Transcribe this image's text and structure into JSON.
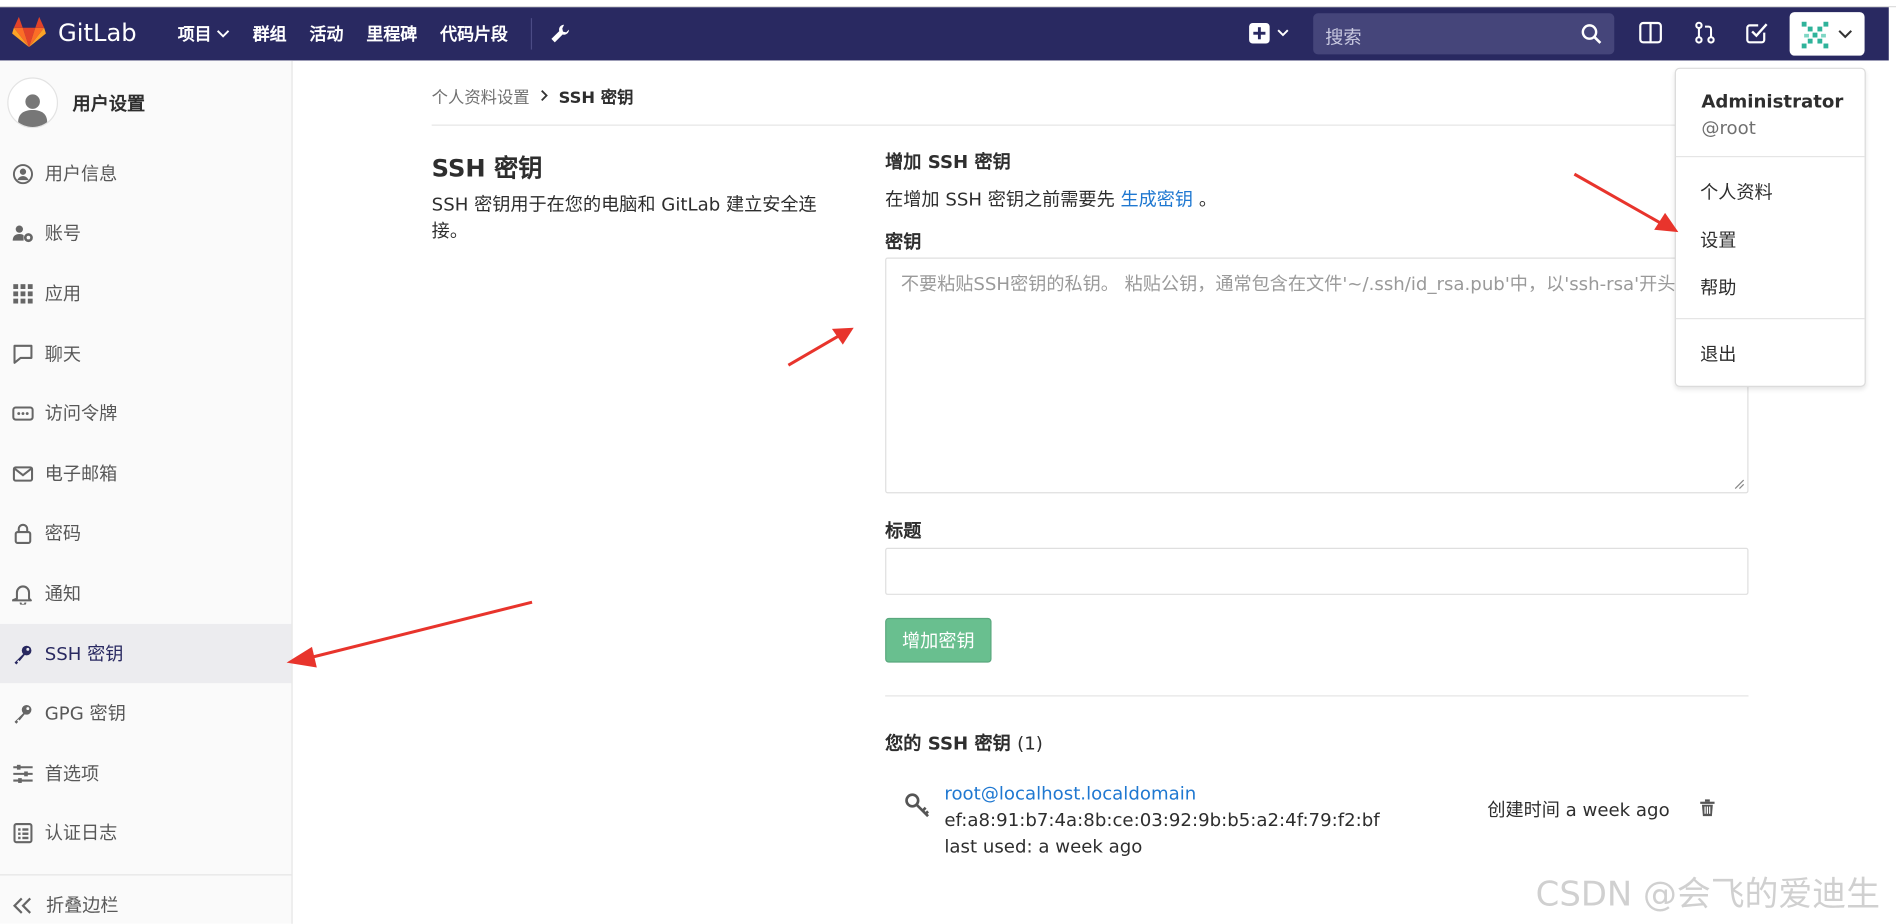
{
  "topbar": {
    "logo_text": "GitLab",
    "nav": [
      {
        "label": "项目",
        "dropdown": true
      },
      {
        "label": "群组",
        "dropdown": false
      },
      {
        "label": "活动",
        "dropdown": false
      },
      {
        "label": "里程碑",
        "dropdown": false
      },
      {
        "label": "代码片段",
        "dropdown": false
      }
    ],
    "search_placeholder": "搜索",
    "bg_color": "#292961"
  },
  "sidebar": {
    "title": "用户设置",
    "items": [
      {
        "label": "用户信息",
        "icon": "user-circle-icon"
      },
      {
        "label": "账号",
        "icon": "account-gear-icon"
      },
      {
        "label": "应用",
        "icon": "grid-icon"
      },
      {
        "label": "聊天",
        "icon": "chat-icon"
      },
      {
        "label": "访问令牌",
        "icon": "token-icon"
      },
      {
        "label": "电子邮箱",
        "icon": "mail-icon"
      },
      {
        "label": "密码",
        "icon": "lock-icon"
      },
      {
        "label": "通知",
        "icon": "bell-icon"
      },
      {
        "label": "SSH 密钥",
        "icon": "key-icon",
        "active": true
      },
      {
        "label": "GPG 密钥",
        "icon": "key-icon"
      },
      {
        "label": "首选项",
        "icon": "sliders-icon"
      },
      {
        "label": "认证日志",
        "icon": "log-icon"
      }
    ],
    "collapse_label": "折叠边栏"
  },
  "breadcrumb": {
    "parent": "个人资料设置",
    "current": "SSH 密钥"
  },
  "left_panel": {
    "title": "SSH 密钥",
    "description": "SSH 密钥用于在您的电脑和 GitLab 建立安全连接。"
  },
  "form": {
    "title": "增加 SSH 密钥",
    "hint_prefix": "在增加 SSH 密钥之前需要先",
    "hint_link": "生成密钥",
    "hint_suffix": "。",
    "key_label": "密钥",
    "key_placeholder": "不要粘贴SSH密钥的私钥。 粘贴公钥，通常包含在文件'~/.ssh/id_rsa.pub'中，以'ssh-rsa'开头。",
    "title_label": "标题",
    "title_value": "",
    "submit_label": "增加密钥",
    "submit_color": "#69bf8f"
  },
  "keys": {
    "heading": "您的 SSH 密钥",
    "count": "(1)",
    "items": [
      {
        "name": "root@localhost.localdomain",
        "fingerprint": "ef:a8:91:b7:4a:8b:ce:03:92:9b:b5:a2:4f:79:f2:bf",
        "last_used": "last used: a week ago",
        "created": "创建时间 a week ago"
      }
    ]
  },
  "user_menu": {
    "name": "Administrator",
    "handle": "@root",
    "items": [
      "个人资料",
      "设置",
      "帮助"
    ],
    "sign_out": "退出"
  },
  "watermark": "CSDN @会飞的爱迪生",
  "annotation_color": "#e8342c"
}
